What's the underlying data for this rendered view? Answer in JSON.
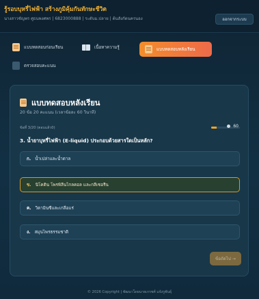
{
  "header": {
    "title": "รู้รอบบุหรี่ไฟฟ้า สร้างภูมิคุ้มกันทักษะชีวิต",
    "subtitle": "นางสาวชัญพร ศูธนพงศพร | 6823000888 | ระดับม.ปลาย | ต้นสังกัดนครนอง",
    "logout_label": "ออกจากระบบ"
  },
  "nav": {
    "items": [
      {
        "label": "แบบทดสอบก่อนเรียน",
        "icon": "document-icon",
        "active": false
      },
      {
        "label": "เนื้อหาความรู้",
        "icon": "book-icon",
        "active": false
      },
      {
        "label": "แบบทดสอบหลังเรียน",
        "icon": "document-icon",
        "active": true
      },
      {
        "label": "ตรวจสอบคะแนน",
        "icon": "checklist-icon",
        "active": false
      }
    ]
  },
  "quiz": {
    "title": "แบบทดสอบหลังเรียน",
    "meta": "20 ข้อ 20 คะแนน (เวลาข้อละ 60 วินาที)",
    "count": "ข้อที่ 3/20 (ตอบแล้ว0)",
    "timer": "60",
    "progress_fraction": 0.2,
    "question": "3. น้ำยาบุหรี่ไฟฟ้า (E-liquid) ประกอบด้วยสารใดเป็นหลัก?",
    "options": [
      {
        "key": "ก.",
        "text": "น้ำเปล่าและน้ำตาล",
        "selected": false
      },
      {
        "key": "ข.",
        "text": "นิโคติน โพรพิลีนไกลคอล และกลีเซอรีน",
        "selected": true
      },
      {
        "key": "ค.",
        "text": "วิตามินซีและเกลือแร่",
        "selected": false
      },
      {
        "key": "ง.",
        "text": "สมุนไพรธรรมชาติ",
        "selected": false
      }
    ],
    "next_label": "ข้อถัดไป →"
  },
  "footer": {
    "text": "© 2026 Copyright | พัฒนาโดยนายเกรชศ์ แจ้งรูพันธุ์"
  }
}
